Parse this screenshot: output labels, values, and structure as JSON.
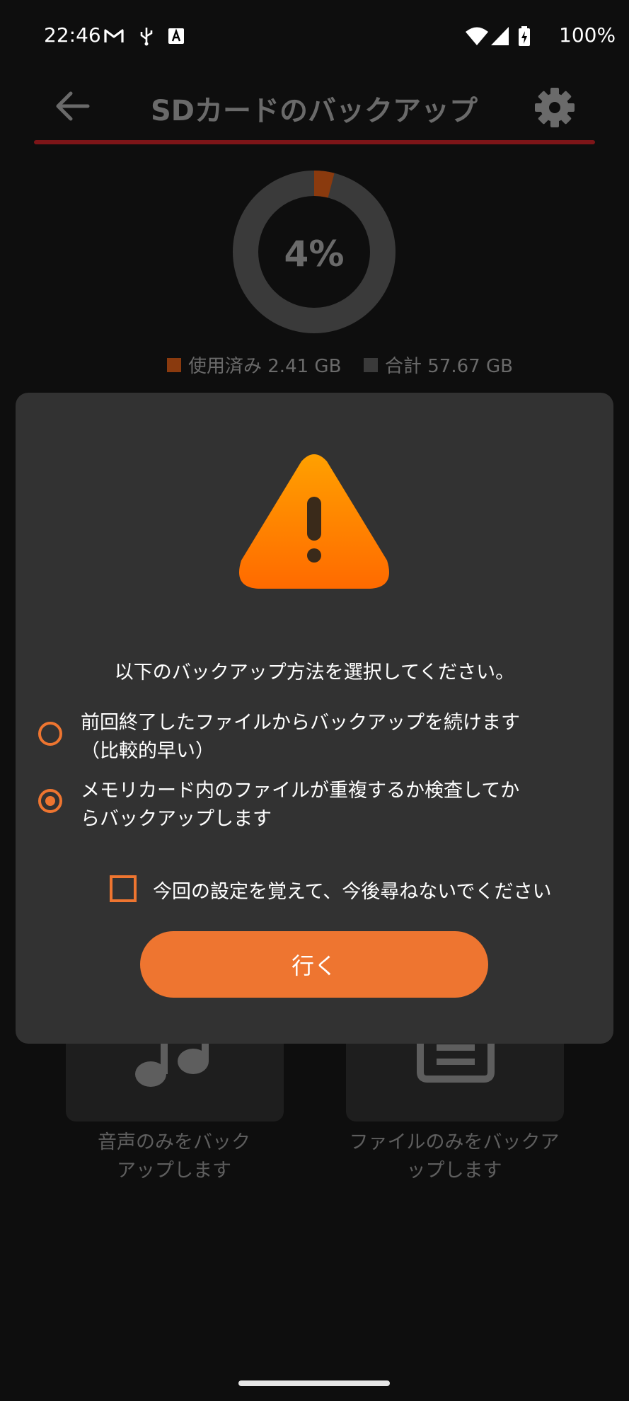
{
  "status_bar": {
    "time": "22:46",
    "battery": "100%",
    "icons": [
      "gmail-icon",
      "usb-icon",
      "font-icon",
      "wifi-icon",
      "signal-icon",
      "battery-charging-icon"
    ]
  },
  "toolbar": {
    "title": "SDカードのバックアップ",
    "back_icon": "back-arrow-icon",
    "settings_icon": "gear-icon"
  },
  "storage": {
    "percent_label": "4%",
    "percent": 4,
    "used_label": "使用済み 2.41 GB",
    "total_label": "合計 57.67 GB",
    "used_color": "#8a3a0e",
    "track_color": "#3a3a3a"
  },
  "background_cards": [
    {
      "label": "音声のみをバック\nアップします",
      "icon": "music-note-icon"
    },
    {
      "label": "ファイルのみをバックア\nップします",
      "icon": "document-icon"
    }
  ],
  "dialog": {
    "icon": "warning-icon",
    "prompt": "以下のバックアップ方法を選択してください。",
    "options": [
      {
        "line1": "前回終了したファイルからバックアップを続けます",
        "line2": "（比較的早い）",
        "selected": false
      },
      {
        "line1": "メモリカード内のファイルが重複するか検査してか",
        "line2": "らバックアップします",
        "selected": true
      }
    ],
    "remember_label": "今回の設定を覚えて、今後尋ねないでください",
    "remember_checked": false,
    "go_button": "行く",
    "accent_color": "#ee7530"
  }
}
